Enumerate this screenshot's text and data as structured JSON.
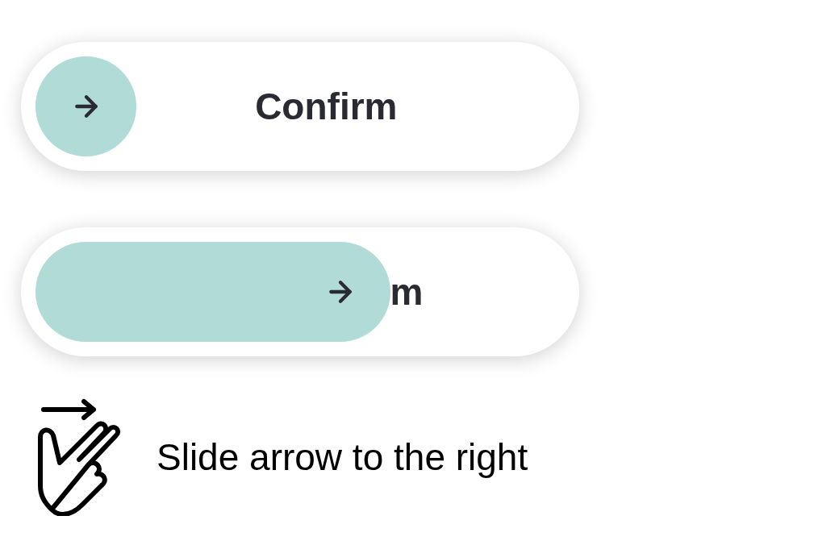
{
  "sliders": [
    {
      "label": "Confirm",
      "level": 0.19
    },
    {
      "label": "m",
      "level": 0.67
    }
  ],
  "hint": {
    "text": "Slide arrow to the right"
  }
}
